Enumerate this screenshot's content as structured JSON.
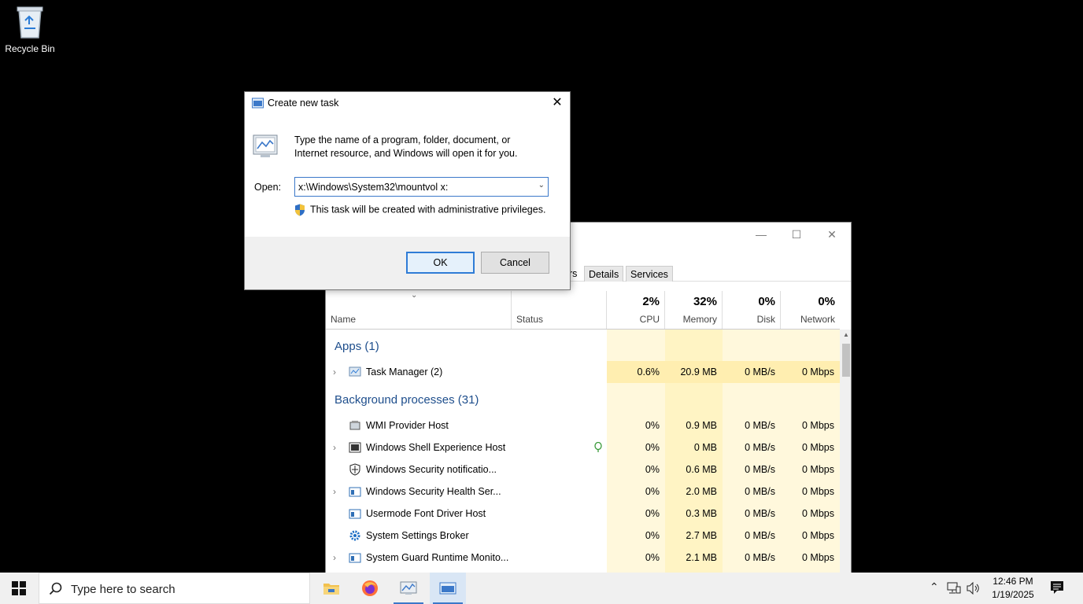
{
  "desktop": {
    "recycle_bin_label": "Recycle Bin"
  },
  "task_manager": {
    "tabs": [
      "rs",
      "Details",
      "Services"
    ],
    "columns": {
      "name": "Name",
      "status": "Status",
      "cpu_pct": "2%",
      "cpu": "CPU",
      "memory_pct": "32%",
      "memory": "Memory",
      "disk_pct": "0%",
      "disk": "Disk",
      "network_pct": "0%",
      "network": "Network"
    },
    "groups": {
      "apps": "Apps (1)",
      "background": "Background processes (31)"
    },
    "rows": [
      {
        "name": "Task Manager (2)",
        "cpu": "0.6%",
        "memory": "20.9 MB",
        "disk": "0 MB/s",
        "network": "0 Mbps"
      },
      {
        "name": "WMI Provider Host",
        "cpu": "0%",
        "memory": "0.9 MB",
        "disk": "0 MB/s",
        "network": "0 Mbps"
      },
      {
        "name": "Windows Shell Experience Host",
        "cpu": "0%",
        "memory": "0 MB",
        "disk": "0 MB/s",
        "network": "0 Mbps"
      },
      {
        "name": "Windows Security notificatio...",
        "cpu": "0%",
        "memory": "0.6 MB",
        "disk": "0 MB/s",
        "network": "0 Mbps"
      },
      {
        "name": "Windows Security Health Ser...",
        "cpu": "0%",
        "memory": "2.0 MB",
        "disk": "0 MB/s",
        "network": "0 Mbps"
      },
      {
        "name": "Usermode Font Driver Host",
        "cpu": "0%",
        "memory": "0.3 MB",
        "disk": "0 MB/s",
        "network": "0 Mbps"
      },
      {
        "name": "System Settings Broker",
        "cpu": "0%",
        "memory": "2.7 MB",
        "disk": "0 MB/s",
        "network": "0 Mbps"
      },
      {
        "name": "System Guard Runtime Monito...",
        "cpu": "0%",
        "memory": "2.1 MB",
        "disk": "0 MB/s",
        "network": "0 Mbps"
      }
    ]
  },
  "dialog": {
    "title": "Create new task",
    "description_line1": "Type the name of a program, folder, document, or",
    "description_line2": "Internet resource, and Windows will open it for you.",
    "open_label": "Open:",
    "open_value": "x:\\Windows\\System32\\mountvol x:",
    "admin_note": "This task will be created with administrative privileges.",
    "ok_label": "OK",
    "cancel_label": "Cancel"
  },
  "taskbar": {
    "search_placeholder": "Type here to search",
    "time": "12:46 PM",
    "date": "1/19/2025"
  },
  "colors": {
    "accent": "#3b78c9",
    "group_heading": "#1e4e8c",
    "heat_light": "#fff4c4",
    "heat_medium": "#ffeeb0"
  }
}
